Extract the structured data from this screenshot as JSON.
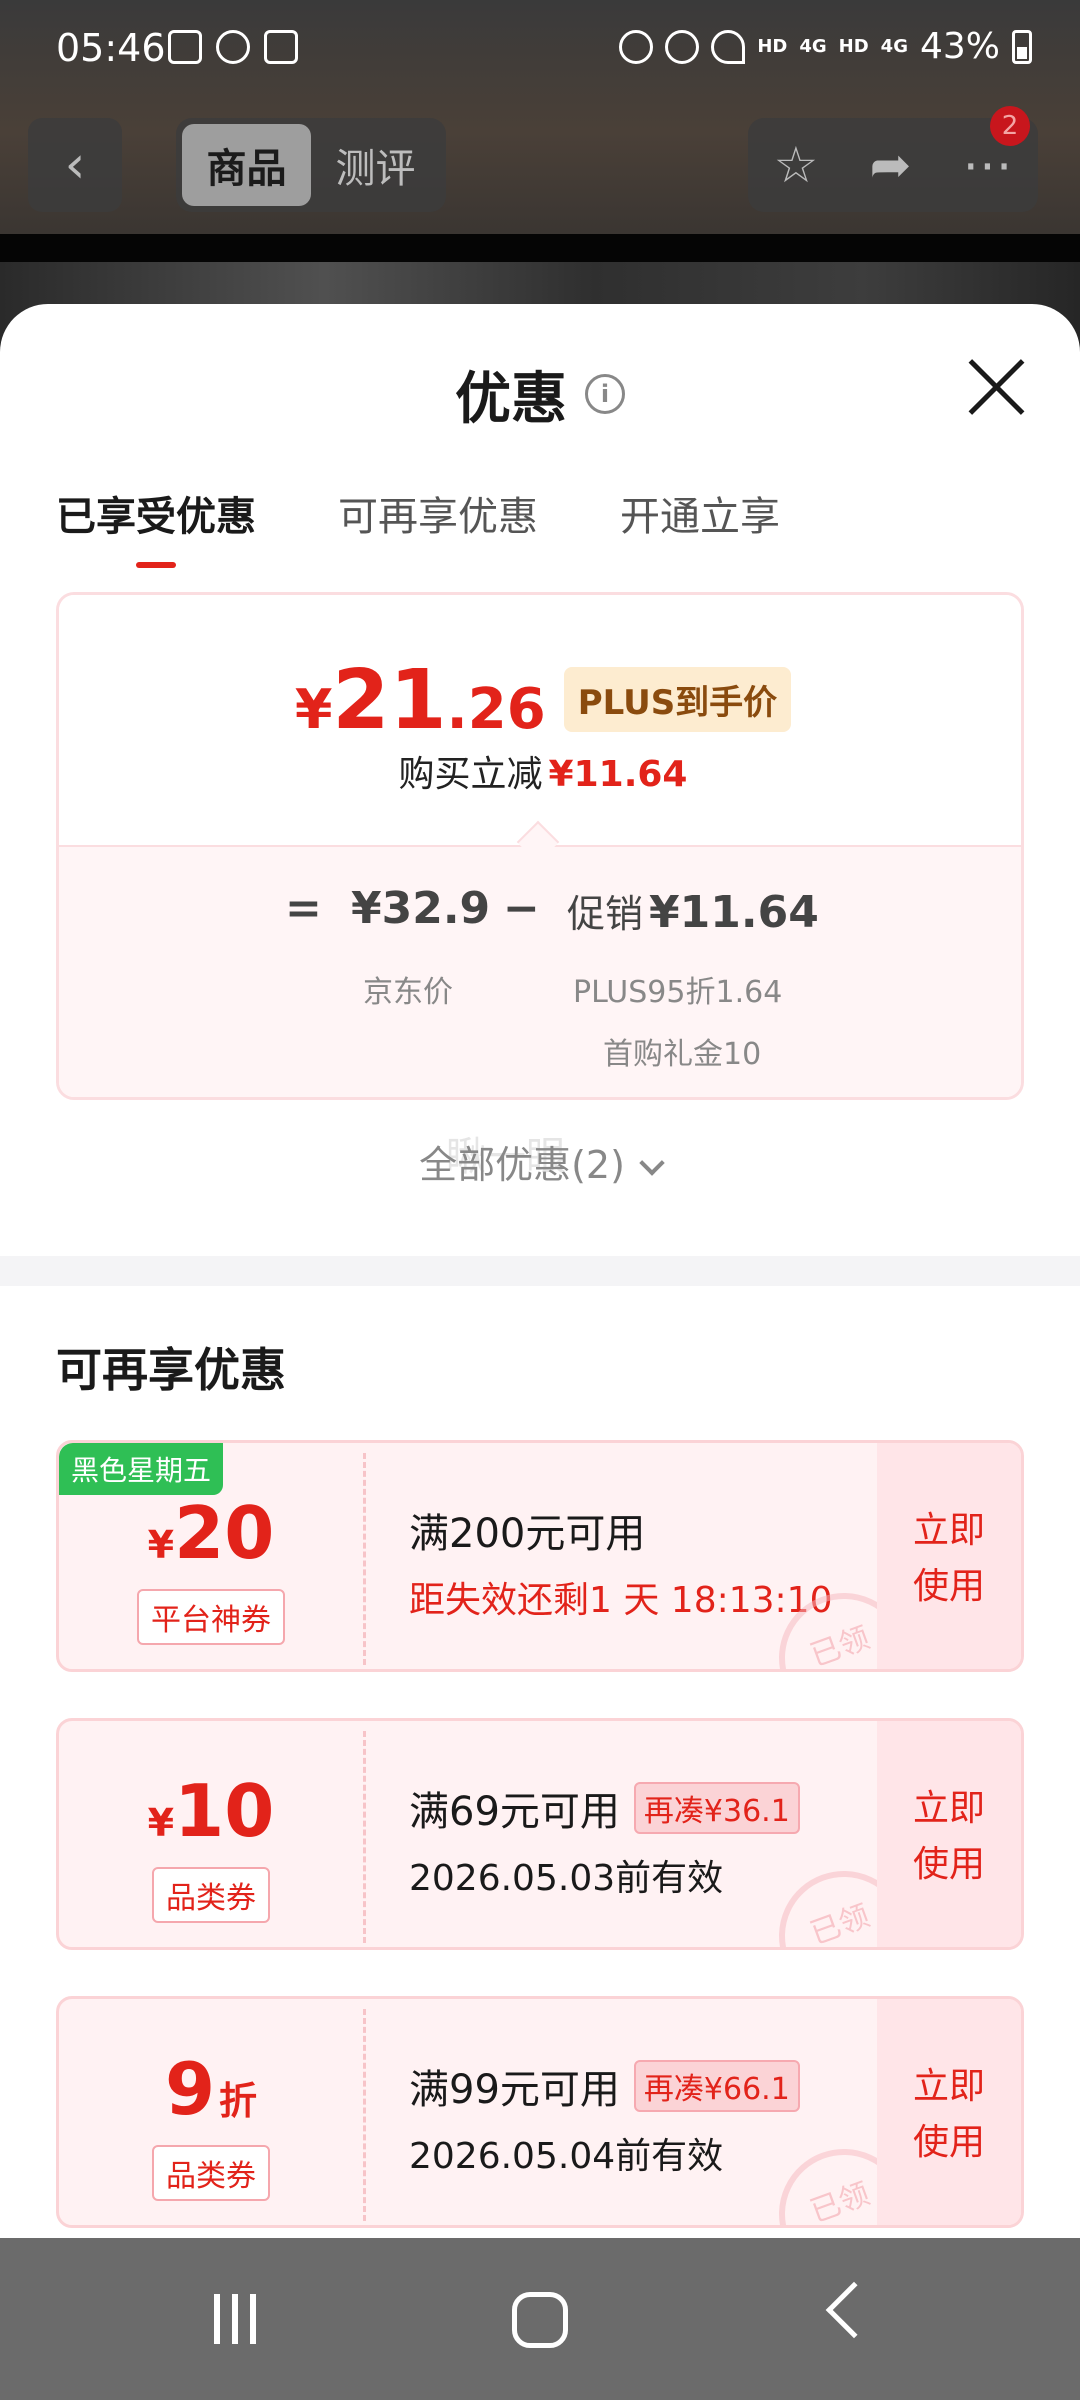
{
  "status_bar": {
    "time": "05:46",
    "battery": "43%",
    "network_labels": [
      "HD",
      "4G",
      "HD",
      "4G"
    ]
  },
  "top_nav": {
    "tabs": [
      "商品",
      "测评"
    ],
    "active_tab": "商品",
    "badge_count": "2"
  },
  "sheet": {
    "title": "优惠",
    "tabs": [
      "已享受优惠",
      "可再享优惠",
      "开通立享"
    ],
    "price_card": {
      "yen": "¥",
      "price_int": "21",
      "price_dec": ".26",
      "plus_label": "PLUS到手价",
      "reduce_label": "购买立减",
      "reduce_value": "¥11.64",
      "eq": "=",
      "jd_price": "¥32.9",
      "minus": "−",
      "promo_label": "促销",
      "promo_value": "¥11.64",
      "jd_label": "京东价",
      "promo_detail_1": "PLUS95折1.64",
      "promo_detail_2": "首购礼金10"
    },
    "all_promos": "全部优惠(2)",
    "watermark": "瞅一眼",
    "section_title": "可再享优惠",
    "coupons": [
      {
        "tag": "黑色星期五",
        "symbol": "¥",
        "value": "20",
        "type": "平台神券",
        "condition": "满200元可用",
        "sub": "距失效还剩1 天 18:13:10",
        "action": "立即使用",
        "stamp": "已领"
      },
      {
        "symbol": "¥",
        "value": "10",
        "type": "品类券",
        "condition": "满69元可用",
        "extra": "再凑¥36.1",
        "sub": "2026.05.03前有效",
        "action": "立即使用",
        "stamp": "已领"
      },
      {
        "value": "9",
        "unit": "折",
        "type": "品类券",
        "condition": "满99元可用",
        "extra": "再凑¥66.1",
        "sub": "2026.05.04前有效",
        "action": "立即使用",
        "stamp": "已领"
      }
    ]
  },
  "colors": {
    "accent_red": "#e2231a",
    "plus_tag_bg": "#fdecd0",
    "coupon_bg": "#fff2f3",
    "tag_green": "#2fbf55"
  }
}
